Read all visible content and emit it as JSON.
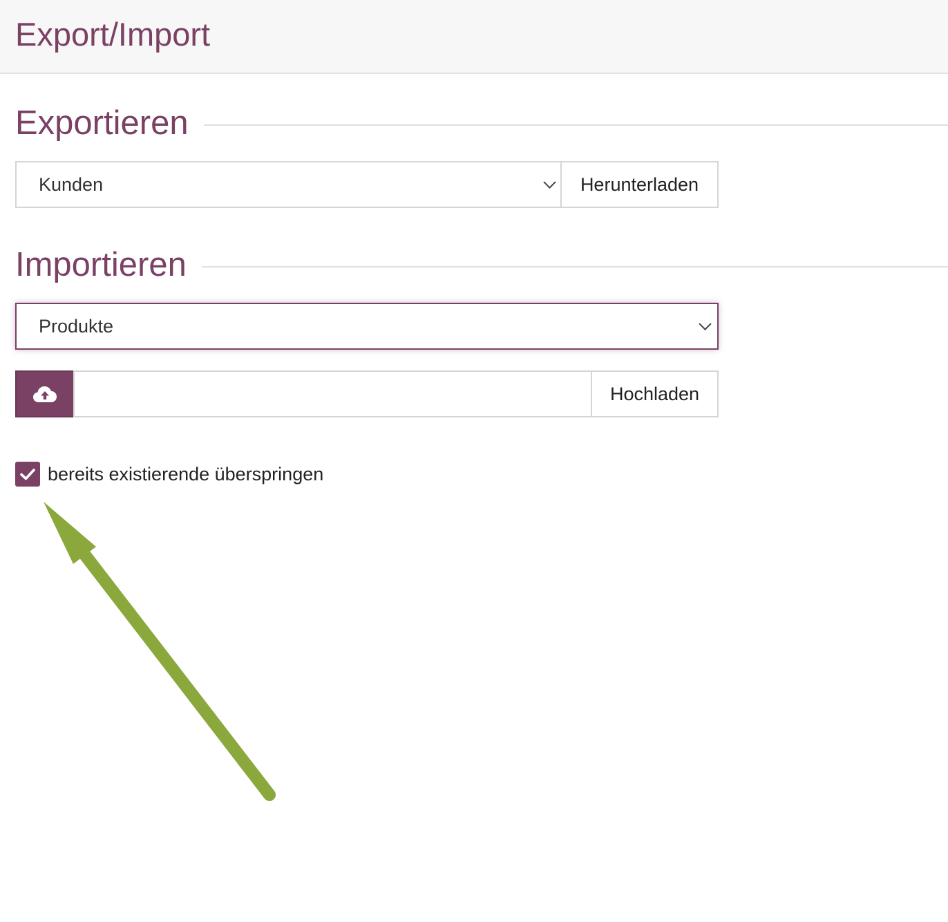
{
  "header": {
    "title": "Export/Import"
  },
  "export": {
    "heading": "Exportieren",
    "selected": "Kunden",
    "download_label": "Herunterladen"
  },
  "import": {
    "heading": "Importieren",
    "selected": "Produkte",
    "upload_label": "Hochladen",
    "file_value": "",
    "skip_existing": {
      "label": "bereits existierende überspringen",
      "checked": true
    }
  },
  "colors": {
    "accent": "#7b4165",
    "annotation_arrow": "#8aa83b"
  },
  "icons": {
    "upload": "cloud-upload-icon",
    "checkbox": "check-icon",
    "dropdown": "chevron-down-icon"
  }
}
